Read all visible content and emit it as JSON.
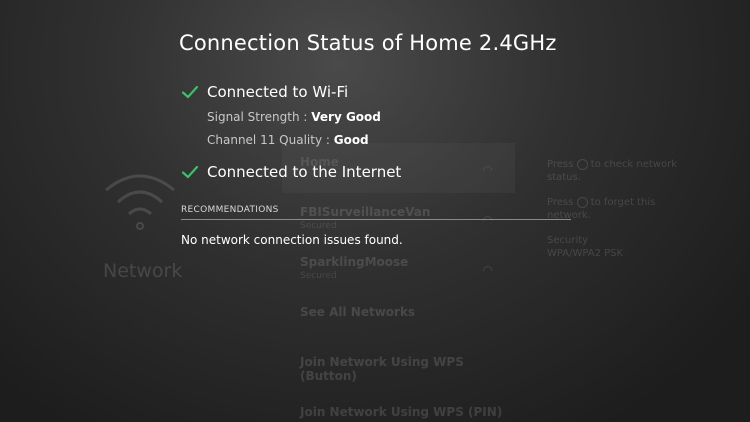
{
  "background": {
    "section_title": "Network",
    "networks": [
      {
        "name": "Home",
        "sub": ""
      },
      {
        "name": "FBISurveillanceVan",
        "sub": "Secured"
      },
      {
        "name": "SparklingMoose",
        "sub": "Secured"
      },
      {
        "name": "See All Networks",
        "sub": ""
      },
      {
        "name": "Join Network Using WPS (Button)",
        "sub": ""
      },
      {
        "name": "Join Network Using WPS (PIN)",
        "sub": ""
      }
    ],
    "side": {
      "hint_check_pre": "Press",
      "hint_check_post": "to check network status.",
      "hint_forget_pre": "Press",
      "hint_forget_post": "to forget this network.",
      "security_label": "Security",
      "security_value": "WPA/WPA2 PSK"
    }
  },
  "overlay": {
    "title": "Connection Status of Home 2.4GHz",
    "wifi_status": "Connected to Wi-Fi",
    "signal_label": "Signal Strength : ",
    "signal_value": "Very Good",
    "channel_label": "Channel 11 Quality : ",
    "channel_value": "Good",
    "internet_status": "Connected to the Internet",
    "recommendations_header": "RECOMMENDATIONS",
    "recommendation_text": "No network connection issues found."
  },
  "colors": {
    "check": "#3dbf6b",
    "text": "#ffffff",
    "muted": "#c8c8c8"
  }
}
